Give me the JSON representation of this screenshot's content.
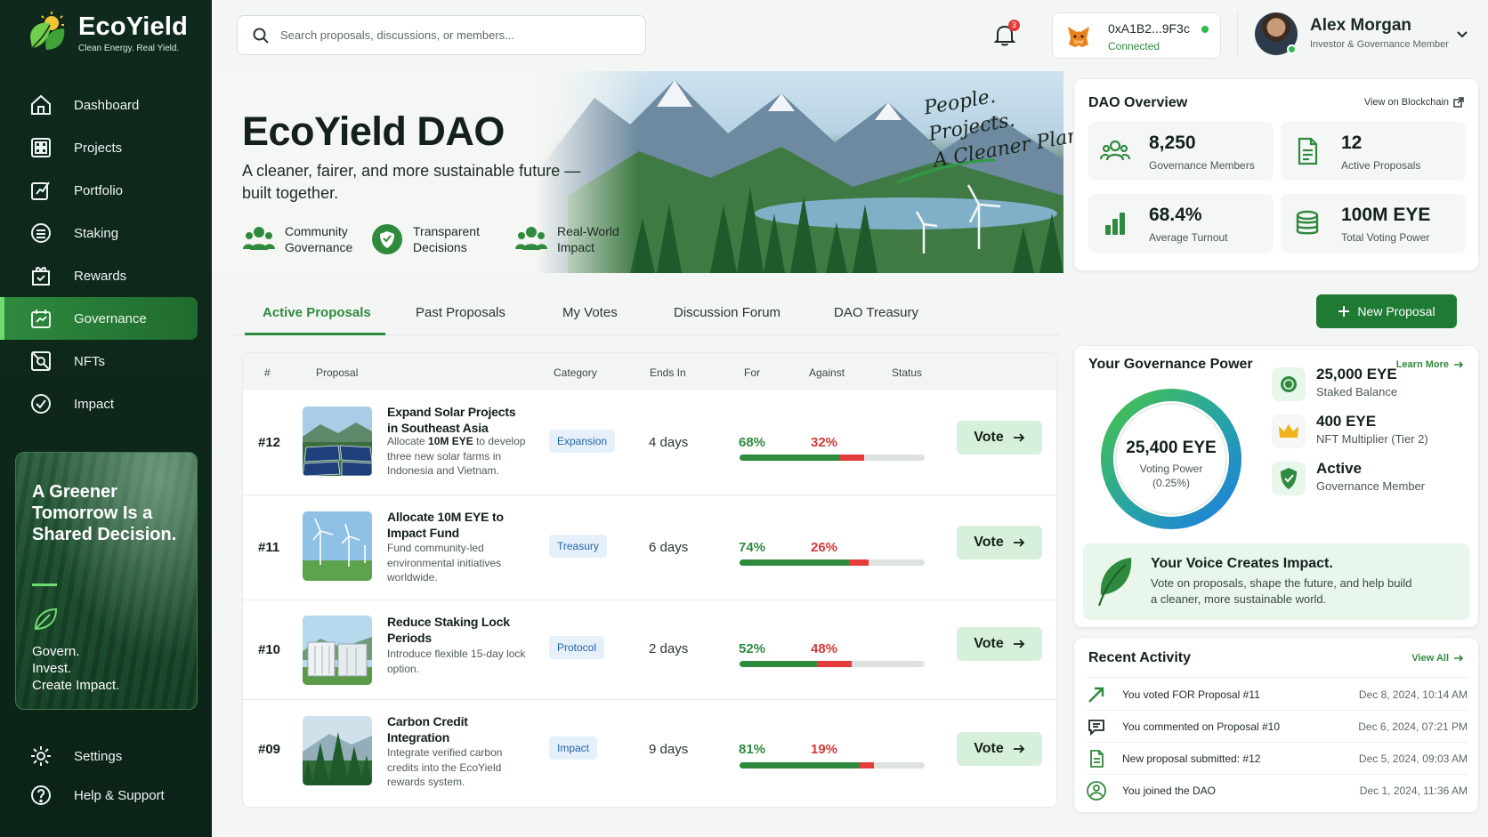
{
  "brand": {
    "name": "EcoYield",
    "tagline": "Clean Energy. Real Yield."
  },
  "sidebar": {
    "items": [
      {
        "label": "Dashboard"
      },
      {
        "label": "Projects"
      },
      {
        "label": "Portfolio"
      },
      {
        "label": "Staking"
      },
      {
        "label": "Rewards"
      },
      {
        "label": "Governance",
        "active": true
      },
      {
        "label": "NFTs"
      },
      {
        "label": "Impact"
      }
    ],
    "promo": {
      "title": "A Greener Tomorrow Is a Shared Decision.",
      "subtitle": "Govern.\nInvest.\nCreate Impact."
    },
    "bottom": [
      {
        "label": "Settings"
      },
      {
        "label": "Help & Support"
      }
    ]
  },
  "header": {
    "search_placeholder": "Search proposals, discussions, or members...",
    "notifications_count": "3",
    "wallet": {
      "address": "0xA1B2...9F3c",
      "status": "Connected"
    },
    "user": {
      "name": "Alex Morgan",
      "role": "Investor & Governance Member"
    }
  },
  "hero": {
    "title": "EcoYield DAO",
    "subtitle": "A cleaner, fairer, and more sustainable future — built together.",
    "features": [
      {
        "label": "Community Governance"
      },
      {
        "label": "Transparent Decisions"
      },
      {
        "label": "Real-World Impact"
      }
    ],
    "script": "People.\nProjects.\nA Cleaner Planet."
  },
  "overview": {
    "title": "DAO Overview",
    "link": "View on Blockchain",
    "stats": [
      {
        "value": "8,250",
        "label": "Governance Members"
      },
      {
        "value": "12",
        "label": "Active Proposals"
      },
      {
        "value": "68.4%",
        "label": "Average Turnout"
      },
      {
        "value": "100M EYE",
        "label": "Total Voting Power"
      }
    ]
  },
  "tabs": [
    {
      "label": "Active Proposals"
    },
    {
      "label": "Past Proposals"
    },
    {
      "label": "My Votes"
    },
    {
      "label": "Discussion Forum"
    },
    {
      "label": "DAO Treasury"
    }
  ],
  "new_proposal_label": "New Proposal",
  "table": {
    "headers": {
      "num": "#",
      "proposal": "Proposal",
      "category": "Category",
      "ends": "Ends In",
      "for": "For",
      "against": "Against",
      "status": "Status"
    },
    "rows": [
      {
        "id": "#12",
        "title": "Expand Solar Projects in Southeast Asia",
        "desc_pre": "Allocate ",
        "desc_bold": "10M EYE",
        "desc_post": " to develop three new solar farms in Indonesia and Vietnam.",
        "category": "Expansion",
        "ends": "4 days",
        "for": "68%",
        "against": "32%",
        "for_pct": 68,
        "against_pct": 32,
        "vote": "Vote"
      },
      {
        "id": "#11",
        "title": "Allocate 10M EYE to Impact Fund",
        "desc_pre": "Fund community-led environmental initiatives worldwide.",
        "desc_bold": "",
        "desc_post": "",
        "category": "Treasury",
        "ends": "6 days",
        "for": "74%",
        "against": "26%",
        "for_pct": 74,
        "against_pct": 26,
        "vote": "Vote"
      },
      {
        "id": "#10",
        "title": "Reduce Staking Lock Periods",
        "desc_pre": "Introduce flexible 15-day lock option.",
        "desc_bold": "",
        "desc_post": "",
        "category": "Protocol",
        "ends": "2 days",
        "for": "52%",
        "against": "48%",
        "for_pct": 52,
        "against_pct": 48,
        "vote": "Vote"
      },
      {
        "id": "#09",
        "title": "Carbon Credit Integration",
        "desc_pre": "Integrate verified carbon credits into the EcoYield rewards system.",
        "desc_bold": "",
        "desc_post": "",
        "category": "Impact",
        "ends": "9 days",
        "for": "81%",
        "against": "19%",
        "for_pct": 81,
        "against_pct": 19,
        "vote": "Vote"
      }
    ]
  },
  "governance_power": {
    "title": "Your Governance Power",
    "link": "Learn More",
    "voting_power": "25,400 EYE",
    "voting_label": "Voting Power\n(0.25%)",
    "items": [
      {
        "value": "25,000 EYE",
        "label": "Staked Balance"
      },
      {
        "value": "400 EYE",
        "label": "NFT Multiplier (Tier 2)"
      },
      {
        "value": "Active",
        "label": "Governance Member"
      }
    ],
    "impact_title": "Your Voice Creates Impact.",
    "impact_desc": "Vote on proposals, shape the future, and help build a cleaner, more sustainable world."
  },
  "recent_activity": {
    "title": "Recent Activity",
    "link": "View All",
    "items": [
      {
        "text": "You voted FOR Proposal #11",
        "date": "Dec 8, 2024, 10:14 AM"
      },
      {
        "text": "You commented on Proposal #10",
        "date": "Dec 6, 2024, 07:21 PM"
      },
      {
        "text": "New proposal submitted: #12",
        "date": "Dec 5, 2024, 09:03 AM"
      },
      {
        "text": "You joined the DAO",
        "date": "Dec 1, 2024, 11:36 AM"
      }
    ]
  },
  "colors": {
    "brand_green": "#2f8a3e",
    "sidebar_bg": "#0f2a1c",
    "against_red": "#e53b3b",
    "category_blue": "#2065a8"
  }
}
